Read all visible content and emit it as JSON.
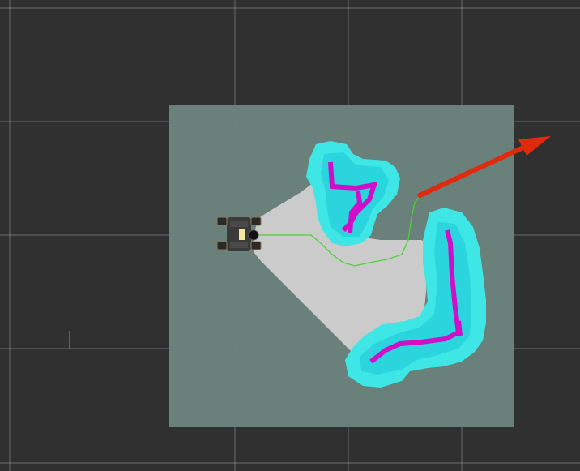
{
  "viewport": {
    "background": "#303030",
    "grid_color": "#a0a0a4",
    "visible_grid_lines": {
      "vertical": 5,
      "horizontal": 4
    }
  },
  "map": {
    "free_color": "#cbcbcb",
    "unknown_color": "#6d8580",
    "inflation_color": "#3ee6e6",
    "inflation_inner_color": "#19c7d6",
    "obstacle_color": "#d10fc8",
    "resolution_cells_per_side": 48
  },
  "robot": {
    "icon": "robot-base-icon",
    "wheels": 4
  },
  "path": {
    "color": "#4fcf3a"
  },
  "goal_arrow": {
    "color": "#e02a0e",
    "icon": "arrow-icon"
  },
  "axis_marker": {
    "color": "#4bb0c8"
  }
}
